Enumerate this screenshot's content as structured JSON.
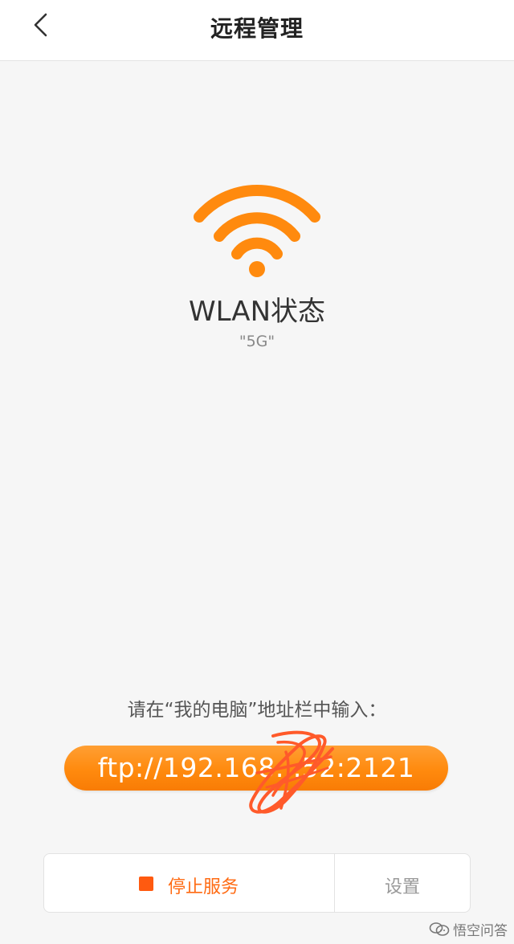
{
  "header": {
    "back_icon": "chevron-left-icon",
    "title": "远程管理"
  },
  "status": {
    "icon": "wifi-icon",
    "title": "WLAN状态",
    "network": "\"5G\""
  },
  "connection": {
    "instruction": "请在“我的电脑”地址栏中输入：",
    "ftp_address": "ftp://192.168.  .52:2121"
  },
  "actions": {
    "stop_label": "停止服务",
    "settings_label": "设置"
  },
  "watermark": {
    "icon": "chat-bubbles-icon",
    "text": "悟空问答"
  },
  "colors": {
    "accent": "#ff8a0e",
    "stop": "#ff5a10",
    "background": "#f6f6f6"
  }
}
